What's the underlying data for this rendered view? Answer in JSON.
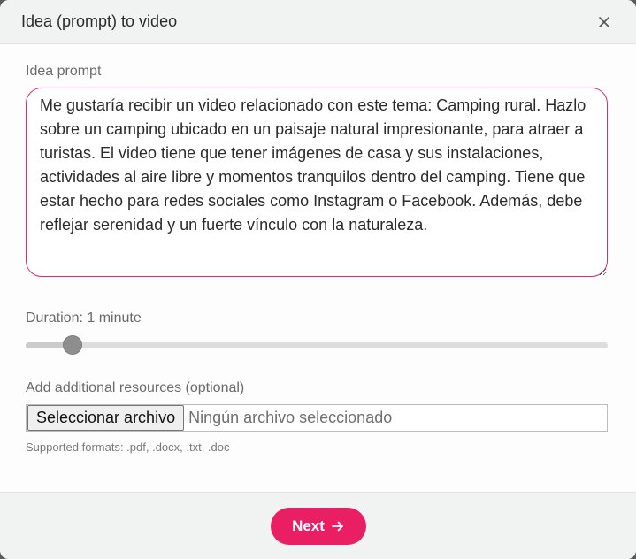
{
  "dialog": {
    "title": "Idea (prompt) to video",
    "close_icon": "close-icon"
  },
  "prompt": {
    "label": "Idea prompt",
    "value": "Me gustaría recibir un video relacionado con este tema: Camping rural. Hazlo sobre un camping ubicado en un paisaje natural impresionante, para atraer a turistas. El video tiene que tener imágenes de casa y sus instalaciones, actividades al aire libre y momentos tranquilos dentro del camping. Tiene que estar hecho para redes sociales como Instagram o Facebook. Además, debe reflejar serenidad y un fuerte vínculo con la naturaleza."
  },
  "duration": {
    "label": "Duration: 1 minute",
    "slider_fraction": 0.08
  },
  "resources": {
    "label": "Add additional resources (optional)",
    "file_button": "Seleccionar archivo",
    "file_status": "Ningún archivo seleccionado",
    "hint": "Supported formats: .pdf, .docx, .txt, .doc"
  },
  "footer": {
    "next_label": "Next",
    "next_icon": "arrow-right-icon"
  },
  "colors": {
    "accent": "#e91e63",
    "prompt_border": "#d1336e"
  }
}
